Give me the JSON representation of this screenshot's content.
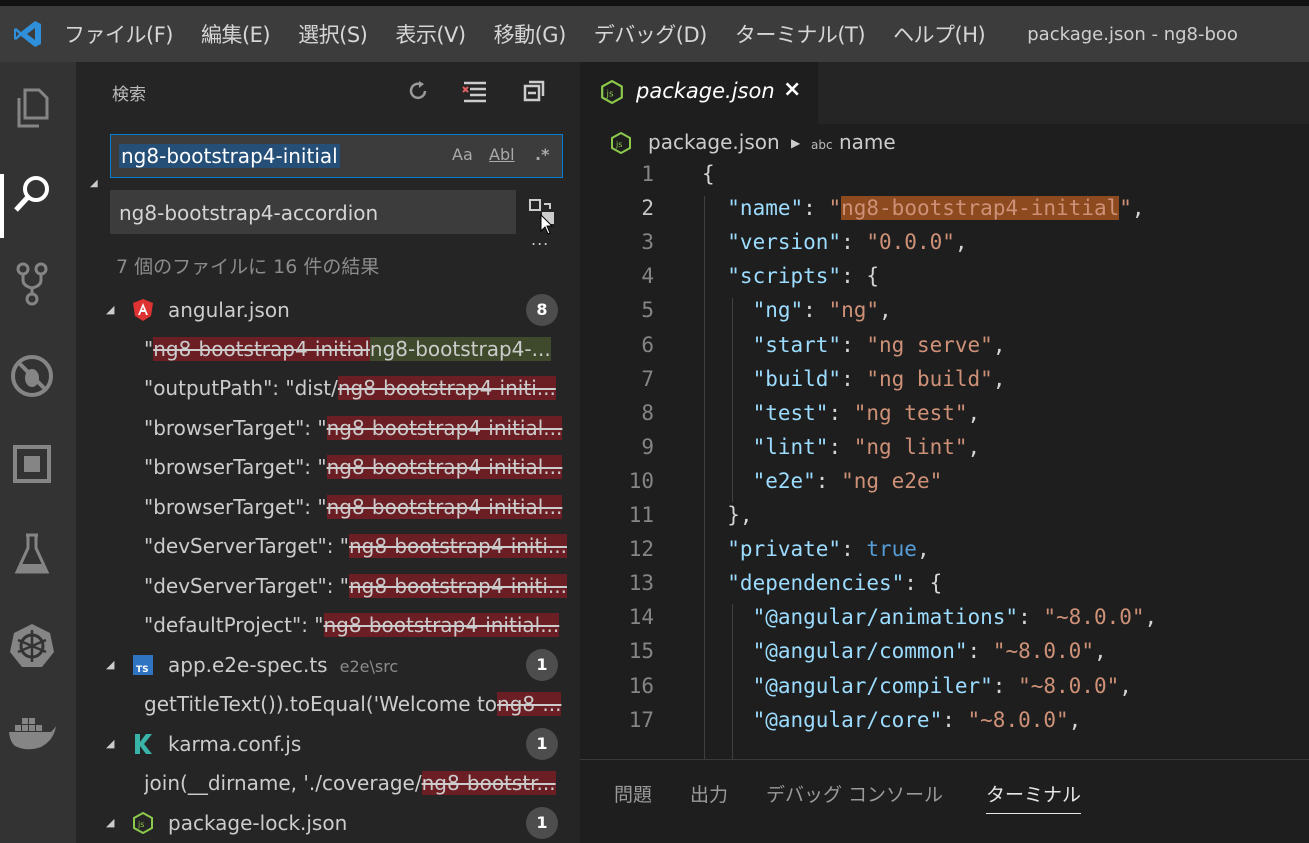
{
  "window": {
    "menu": [
      "ファイル(F)",
      "編集(E)",
      "選択(S)",
      "表示(V)",
      "移動(G)",
      "デバッグ(D)",
      "ターミナル(T)",
      "ヘルプ(H)"
    ],
    "title": "package.json - ng8-boo"
  },
  "activity_bar": {
    "icons": [
      "explorer-icon",
      "search-icon",
      "source-control-icon",
      "debug-icon",
      "extensions-icon",
      "test-flask-icon",
      "kubernetes-icon",
      "docker-icon"
    ],
    "active": "search-icon"
  },
  "search": {
    "title": "検索",
    "query": "ng8-bootstrap4-initial",
    "opt_case": "Aa",
    "opt_word": "Abl",
    "opt_regex": ".*",
    "replace": "ng8-bootstrap4-accordion",
    "more": "...",
    "summary": "7 個のファイルに 16 件の結果"
  },
  "results": [
    {
      "file": "angular.json",
      "path": "",
      "icon": "angular-icon",
      "count": "8",
      "matches": [
        {
          "prefix": "\"",
          "old": "ng8-bootstrap4-initial",
          "new": "ng8-bootstrap4-..."
        },
        {
          "prefix": "\"outputPath\": \"dist/",
          "old": "ng8-bootstrap4-initi...",
          "new": ""
        },
        {
          "prefix": "\"browserTarget\": \"",
          "old": "ng8-bootstrap4-initial...",
          "new": ""
        },
        {
          "prefix": "\"browserTarget\": \"",
          "old": "ng8-bootstrap4-initial...",
          "new": ""
        },
        {
          "prefix": "\"browserTarget\": \"",
          "old": "ng8-bootstrap4-initial...",
          "new": ""
        },
        {
          "prefix": "\"devServerTarget\": \"",
          "old": "ng8-bootstrap4-initi...",
          "new": ""
        },
        {
          "prefix": "\"devServerTarget\": \"",
          "old": "ng8-bootstrap4-initi...",
          "new": ""
        },
        {
          "prefix": "\"defaultProject\": \"",
          "old": "ng8-bootstrap4-initial...",
          "new": ""
        }
      ]
    },
    {
      "file": "app.e2e-spec.ts",
      "path": "e2e\\src",
      "icon": "typescript-icon",
      "count": "1",
      "matches": [
        {
          "prefix": "getTitleText()).toEqual('Welcome to ",
          "old": "ng8-...",
          "new": ""
        }
      ]
    },
    {
      "file": "karma.conf.js",
      "path": "",
      "icon": "karma-icon",
      "count": "1",
      "matches": [
        {
          "prefix": "join(__dirname, './coverage/",
          "old": "ng8-bootstr...",
          "new": ""
        }
      ]
    },
    {
      "file": "package-lock.json",
      "path": "",
      "icon": "nodejs-icon",
      "count": "1",
      "matches": []
    }
  ],
  "editor": {
    "tab": "package.json",
    "breadcrumb_file": "package.json",
    "breadcrumb_symbol_icon": "abc",
    "breadcrumb_symbol": "name",
    "lines": [
      {
        "n": "1",
        "parts": [
          [
            "p",
            "{"
          ]
        ]
      },
      {
        "n": "2",
        "parts": [
          [
            "k",
            "  \"name\""
          ],
          [
            "p",
            ": "
          ],
          [
            "s",
            "\""
          ],
          [
            "hl",
            "ng8-bootstrap4-initial"
          ],
          [
            "s",
            "\""
          ],
          [
            "p",
            ","
          ]
        ]
      },
      {
        "n": "3",
        "parts": [
          [
            "k",
            "  \"version\""
          ],
          [
            "p",
            ": "
          ],
          [
            "s",
            "\"0.0.0\""
          ],
          [
            "p",
            ","
          ]
        ]
      },
      {
        "n": "4",
        "parts": [
          [
            "k",
            "  \"scripts\""
          ],
          [
            "p",
            ": {"
          ]
        ]
      },
      {
        "n": "5",
        "parts": [
          [
            "k",
            "    \"ng\""
          ],
          [
            "p",
            ": "
          ],
          [
            "s",
            "\"ng\""
          ],
          [
            "p",
            ","
          ]
        ]
      },
      {
        "n": "6",
        "parts": [
          [
            "k",
            "    \"start\""
          ],
          [
            "p",
            ": "
          ],
          [
            "s",
            "\"ng serve\""
          ],
          [
            "p",
            ","
          ]
        ]
      },
      {
        "n": "7",
        "parts": [
          [
            "k",
            "    \"build\""
          ],
          [
            "p",
            ": "
          ],
          [
            "s",
            "\"ng build\""
          ],
          [
            "p",
            ","
          ]
        ]
      },
      {
        "n": "8",
        "parts": [
          [
            "k",
            "    \"test\""
          ],
          [
            "p",
            ": "
          ],
          [
            "s",
            "\"ng test\""
          ],
          [
            "p",
            ","
          ]
        ]
      },
      {
        "n": "9",
        "parts": [
          [
            "k",
            "    \"lint\""
          ],
          [
            "p",
            ": "
          ],
          [
            "s",
            "\"ng lint\""
          ],
          [
            "p",
            ","
          ]
        ]
      },
      {
        "n": "10",
        "parts": [
          [
            "k",
            "    \"e2e\""
          ],
          [
            "p",
            ": "
          ],
          [
            "s",
            "\"ng e2e\""
          ]
        ]
      },
      {
        "n": "11",
        "parts": [
          [
            "p",
            "  },"
          ]
        ]
      },
      {
        "n": "12",
        "parts": [
          [
            "k",
            "  \"private\""
          ],
          [
            "p",
            ": "
          ],
          [
            "b",
            "true"
          ],
          [
            "p",
            ","
          ]
        ]
      },
      {
        "n": "13",
        "parts": [
          [
            "k",
            "  \"dependencies\""
          ],
          [
            "p",
            ": {"
          ]
        ]
      },
      {
        "n": "14",
        "parts": [
          [
            "k",
            "    \"@angular/animations\""
          ],
          [
            "p",
            ": "
          ],
          [
            "s",
            "\"~8.0.0\""
          ],
          [
            "p",
            ","
          ]
        ]
      },
      {
        "n": "15",
        "parts": [
          [
            "k",
            "    \"@angular/common\""
          ],
          [
            "p",
            ": "
          ],
          [
            "s",
            "\"~8.0.0\""
          ],
          [
            "p",
            ","
          ]
        ]
      },
      {
        "n": "16",
        "parts": [
          [
            "k",
            "    \"@angular/compiler\""
          ],
          [
            "p",
            ": "
          ],
          [
            "s",
            "\"~8.0.0\""
          ],
          [
            "p",
            ","
          ]
        ]
      },
      {
        "n": "17",
        "parts": [
          [
            "k",
            "    \"@angular/core\""
          ],
          [
            "p",
            ": "
          ],
          [
            "s",
            "\"~8.0.0\""
          ],
          [
            "p",
            ","
          ]
        ]
      }
    ],
    "current_line": "2"
  },
  "panel": {
    "tabs": [
      "問題",
      "出力",
      "デバッグ コンソール",
      "ターミナル"
    ],
    "active": "ターミナル"
  },
  "colors": {
    "accent": "#007fd4",
    "removed": "#6b1f24",
    "inserted": "#3f4a2c",
    "highlight": "#8c4a1e"
  }
}
